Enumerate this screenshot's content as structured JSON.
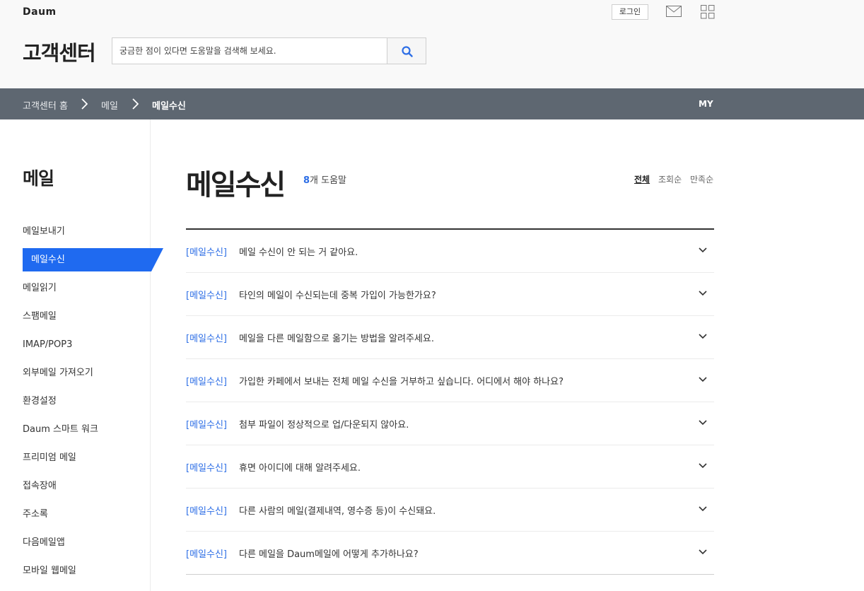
{
  "header": {
    "logo": "Daum",
    "login_label": "로그인",
    "center_title": "고객센터",
    "search_placeholder": "궁금한 점이 있다면 도움말을 검색해 보세요."
  },
  "breadcrumb": {
    "items": [
      "고객센터 홈",
      "메일",
      "메일수신"
    ],
    "my_label": "MY"
  },
  "sidebar": {
    "title": "메일",
    "items": [
      "메일보내기",
      "메일수신",
      "메일읽기",
      "스팸메일",
      "IMAP/POP3",
      "외부메일 가져오기",
      "환경설정",
      "Daum 스마트 워크",
      "프리미엄 메일",
      "접속장애",
      "주소록",
      "다음메일앱",
      "모바일 웹메일"
    ],
    "active_index": 1
  },
  "main": {
    "title": "메일수신",
    "count_number": "8",
    "count_suffix": "개 도움말",
    "sort_options": [
      "전체",
      "조회순",
      "만족순"
    ],
    "sort_active": 0,
    "faqs": [
      {
        "category": "[메일수신]",
        "text": "메일 수신이 안 되는 거 같아요."
      },
      {
        "category": "[메일수신]",
        "text": "타인의 메일이 수신되는데 중복 가입이 가능한가요?"
      },
      {
        "category": "[메일수신]",
        "text": "메일을 다른 메일함으로 옮기는 방법을 알려주세요."
      },
      {
        "category": "[메일수신]",
        "text": "가입한 카페에서 보내는 전체 메일 수신을 거부하고 싶습니다. 어디에서 해야 하나요?"
      },
      {
        "category": "[메일수신]",
        "text": "첨부 파일이 정상적으로 업/다운되지 않아요."
      },
      {
        "category": "[메일수신]",
        "text": "휴면 아이디에 대해 알려주세요."
      },
      {
        "category": "[메일수신]",
        "text": "다른 사람의 메일(결제내역, 영수증 등)이 수신돼요."
      },
      {
        "category": "[메일수신]",
        "text": "다른 메일을 Daum메일에 어떻게 추가하나요?"
      }
    ]
  },
  "colors": {
    "accent_blue": "#2d6ee6",
    "active_menu_bg": "#1f6af0",
    "crumb_bar_bg": "#5e6771"
  }
}
